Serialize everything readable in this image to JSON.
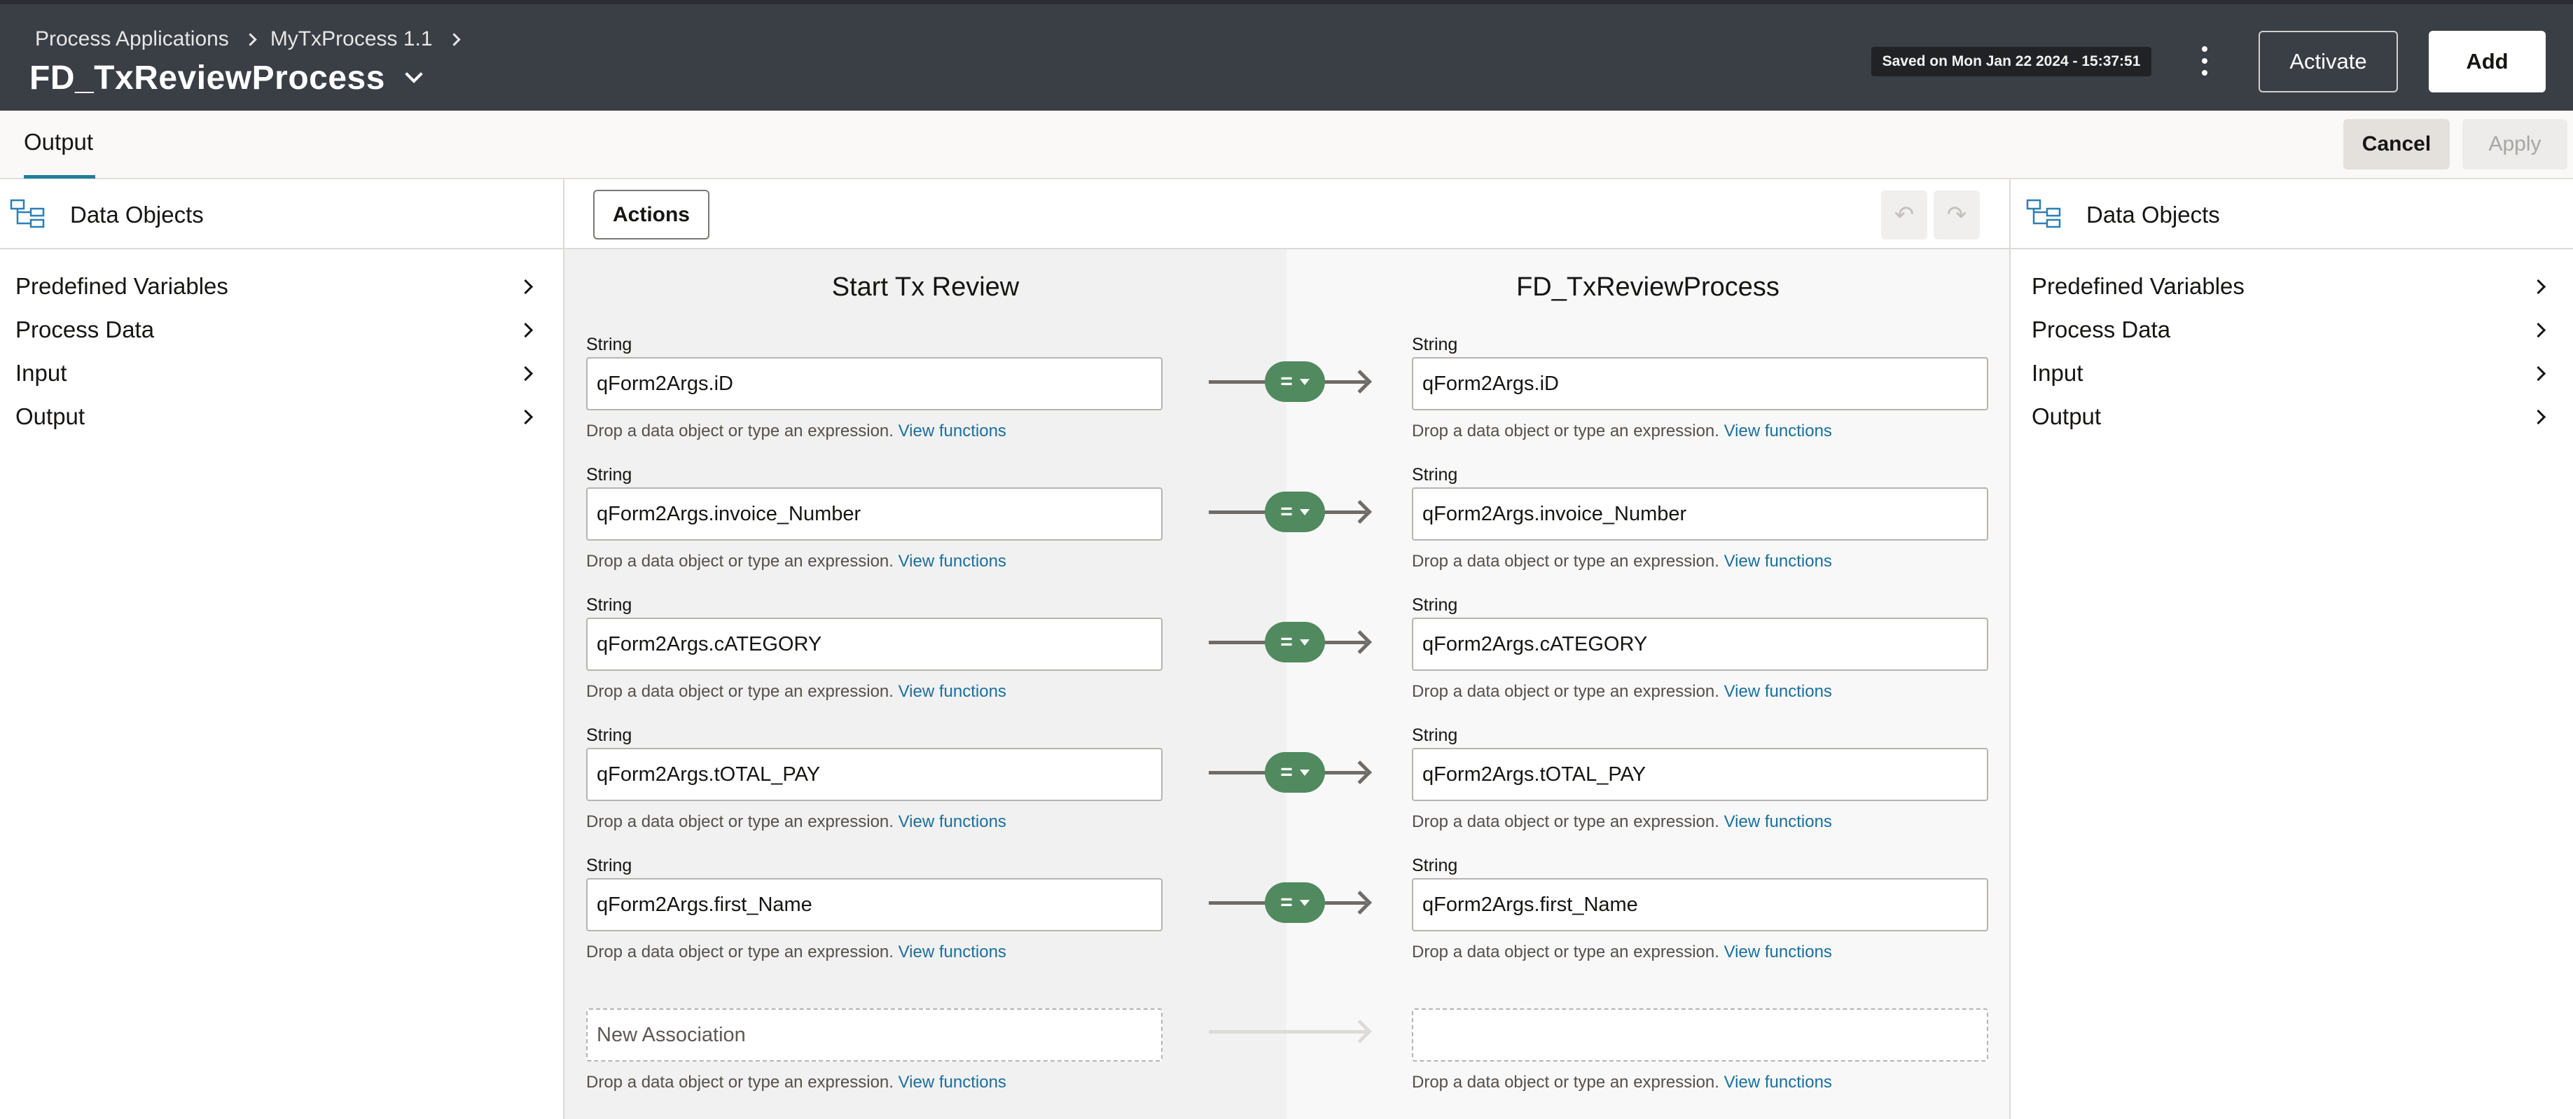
{
  "header": {
    "breadcrumb": [
      "Process Applications",
      "MyTxProcess 1.1"
    ],
    "title": "FD_TxReviewProcess",
    "saved_text": "Saved on Mon Jan 22 2024 - 15:37:51",
    "activate_label": "Activate",
    "add_label": "Add"
  },
  "tabbar": {
    "tab_label": "Output",
    "cancel_label": "Cancel",
    "apply_label": "Apply"
  },
  "left_panel": {
    "title": "Data Objects",
    "items": [
      "Predefined Variables",
      "Process Data",
      "Input",
      "Output"
    ]
  },
  "right_panel": {
    "title": "Data Objects",
    "items": [
      "Predefined Variables",
      "Process Data",
      "Input",
      "Output"
    ]
  },
  "mapping": {
    "actions_label": "Actions",
    "source_title": "Start Tx Review",
    "target_title": "FD_TxReviewProcess",
    "hint_text": "Drop a data object or type an expression.",
    "hint_link": "View functions",
    "operator": "=",
    "rows": [
      {
        "type": "String",
        "source": "qForm2Args.iD",
        "target": "qForm2Args.iD"
      },
      {
        "type": "String",
        "source": "qForm2Args.invoice_Number",
        "target": "qForm2Args.invoice_Number"
      },
      {
        "type": "String",
        "source": "qForm2Args.cATEGORY",
        "target": "qForm2Args.cATEGORY"
      },
      {
        "type": "String",
        "source": "qForm2Args.tOTAL_PAY",
        "target": "qForm2Args.tOTAL_PAY"
      },
      {
        "type": "String",
        "source": "qForm2Args.first_Name",
        "target": "qForm2Args.first_Name"
      }
    ],
    "new_association": {
      "source_placeholder": "New Association",
      "target_value": ""
    }
  },
  "colors": {
    "header_bg": "#3a3e45",
    "operator_green": "#508a5e",
    "link_blue": "#1a6f9d",
    "tab_accent": "#227e9e"
  }
}
